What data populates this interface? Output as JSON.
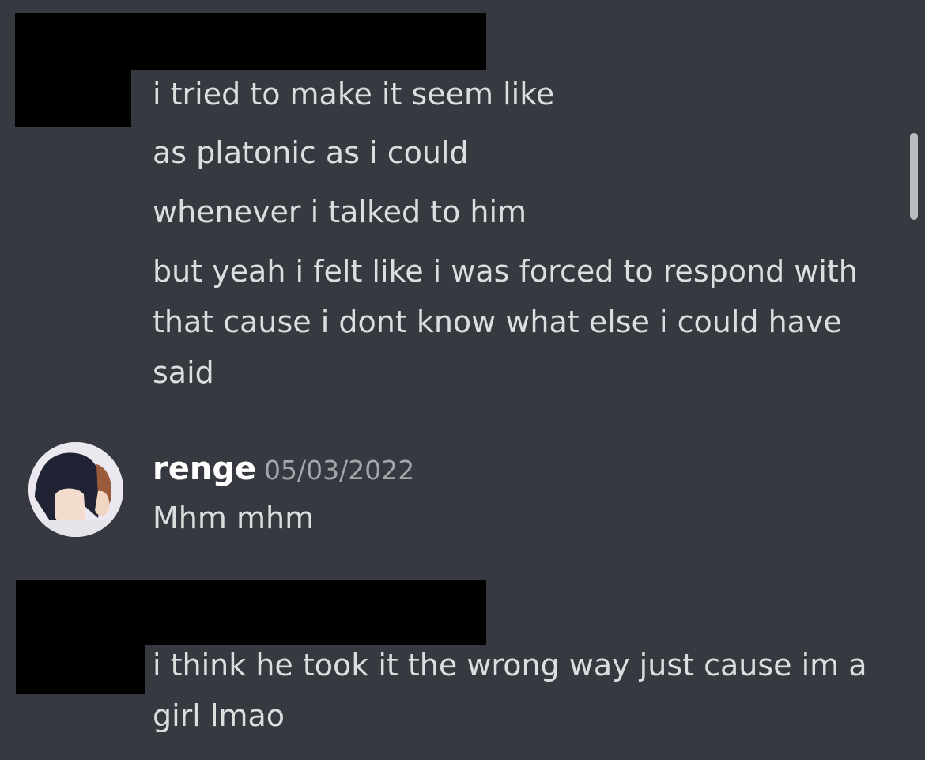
{
  "group1": {
    "lines": [
      "i tried to make it seem like",
      "as platonic as i could",
      "whenever i talked to him",
      "but yeah i felt like i was forced to respond with that cause i dont know what else i could have said"
    ]
  },
  "message_renge": {
    "username": "renge",
    "timestamp": "05/03/2022",
    "text": "Mhm mhm"
  },
  "group2": {
    "lines": [
      "i think he took it the wrong way just cause im a girl lmao"
    ]
  },
  "colors": {
    "background": "#36393f",
    "text": "#dcddde",
    "username": "#ffffff",
    "timestamp": "#a3a6aa",
    "redaction": "#000000"
  }
}
